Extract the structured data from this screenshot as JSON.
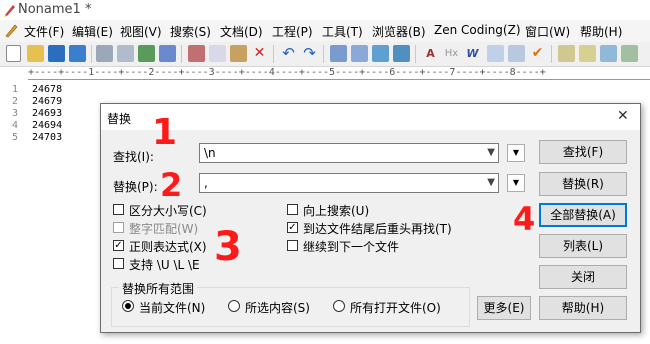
{
  "app": {
    "title": "Noname1 *",
    "colors": {
      "accent": "#0078d7",
      "annotation": "#ff1a1a"
    }
  },
  "menu": {
    "items": [
      "文件(F)",
      "编辑(E)",
      "视图(V)",
      "搜索(S)",
      "文档(D)",
      "工程(P)",
      "工具(T)",
      "浏览器(B)",
      "Zen Coding(Z)",
      "窗口(W)",
      "帮助(H)"
    ]
  },
  "toolbar": {
    "icons": [
      "new-file-icon",
      "open-file-icon",
      "save-icon",
      "save-all-icon",
      "print-icon",
      "print-preview-icon",
      "spellcheck-icon",
      "find-icon",
      "cut-icon",
      "copy-icon",
      "paste-icon",
      "delete-icon",
      "undo-icon",
      "redo-icon",
      "search-icon",
      "replace-icon",
      "goto-icon",
      "indent-icon",
      "font-icon",
      "hex-icon",
      "word-wrap-icon",
      "align-icon",
      "column-mode-icon",
      "check-icon",
      "window-icon",
      "panel-icon",
      "image-icon",
      "clip-icon"
    ]
  },
  "ruler": {
    "text": "+----+----1----+----2----+----3----+----4----+----5----+----6----+----7----+----8----+"
  },
  "editor": {
    "line_numbers": [
      "1",
      "2",
      "3",
      "4",
      "5"
    ],
    "lines": [
      "24678",
      "24679",
      "24693",
      "24694",
      "24703"
    ]
  },
  "dialog": {
    "title": "替换",
    "close": "✕",
    "find_label": "查找(I):",
    "find_value": "\\n",
    "replace_label": "替换(P):",
    "replace_value": ",",
    "options": {
      "match_case": {
        "label": "区分大小写(C)",
        "checked": false
      },
      "whole_word": {
        "label": "整字匹配(W)",
        "checked": false,
        "disabled": true
      },
      "regex": {
        "label": "正则表达式(X)",
        "checked": true
      },
      "escape": {
        "label": "支持 \\U \\L \\E",
        "checked": false
      },
      "search_up": {
        "label": "向上搜索(U)",
        "checked": false
      },
      "wrap": {
        "label": "到达文件结尾后重头再找(T)",
        "checked": true
      },
      "continue_next": {
        "label": "继续到下一个文件",
        "checked": false
      }
    },
    "scope": {
      "title": "替换所有范围",
      "current_file": "当前文件(N)",
      "selection": "所选内容(S)",
      "all_open": "所有打开文件(O)",
      "selected": "current_file"
    },
    "buttons": {
      "find": "查找(F)",
      "replace": "替换(R)",
      "replace_all": "全部替换(A)",
      "list": "列表(L)",
      "close": "关闭",
      "more": "更多(E)",
      "help": "帮助(H)"
    }
  },
  "annotations": {
    "one": "1",
    "two": "2",
    "three": "3",
    "four": "4"
  }
}
